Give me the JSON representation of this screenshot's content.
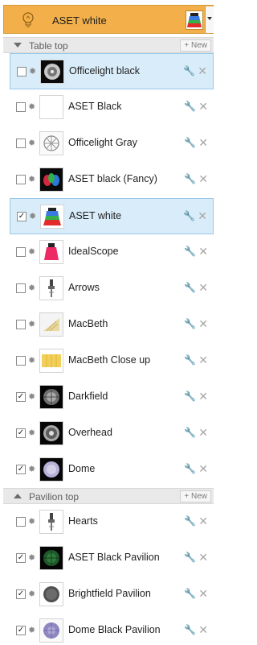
{
  "header": {
    "title": "ASET white",
    "icons": {
      "bulb": "lightbulb-icon",
      "dropdown": "chevron-down-icon"
    }
  },
  "sections": [
    {
      "label": "Table top",
      "new_label": "+ New",
      "items": [
        {
          "label": "Officelight black",
          "checked": false,
          "selected": true,
          "thumb": "officelight-black"
        },
        {
          "label": "ASET Black",
          "checked": false,
          "selected": false,
          "thumb": "blank"
        },
        {
          "label": "Officelight Gray",
          "checked": false,
          "selected": false,
          "thumb": "officelight-gray"
        },
        {
          "label": "ASET black (Fancy)",
          "checked": false,
          "selected": false,
          "thumb": "aset-fancy"
        },
        {
          "label": "ASET white",
          "checked": true,
          "selected": true,
          "thumb": "aset-white"
        },
        {
          "label": "IdealScope",
          "checked": false,
          "selected": false,
          "thumb": "idealscope"
        },
        {
          "label": "Arrows",
          "checked": false,
          "selected": false,
          "thumb": "arrows"
        },
        {
          "label": "MacBeth",
          "checked": false,
          "selected": false,
          "thumb": "macbeth"
        },
        {
          "label": "MacBeth Close up",
          "checked": false,
          "selected": false,
          "thumb": "macbeth-close"
        },
        {
          "label": "Darkfield",
          "checked": true,
          "selected": false,
          "thumb": "darkfield"
        },
        {
          "label": "Overhead",
          "checked": true,
          "selected": false,
          "thumb": "overhead"
        },
        {
          "label": "Dome",
          "checked": true,
          "selected": false,
          "thumb": "dome"
        }
      ]
    },
    {
      "label": "Pavilion top",
      "new_label": "+ New",
      "items": [
        {
          "label": "Hearts",
          "checked": false,
          "selected": false,
          "thumb": "hearts"
        },
        {
          "label": "ASET Black Pavilion",
          "checked": true,
          "selected": false,
          "thumb": "aset-black-pavilion"
        },
        {
          "label": "Brightfield Pavilion",
          "checked": true,
          "selected": false,
          "thumb": "brightfield-pavilion"
        },
        {
          "label": "Dome Black Pavilion",
          "checked": true,
          "selected": false,
          "thumb": "dome-black-pavilion"
        }
      ]
    }
  ],
  "colors": {
    "header_bg": "#f3b04a",
    "selected_bg": "#d9ecf9",
    "selected_border": "#99c9ea",
    "section_bg": "#e9e9e9"
  }
}
